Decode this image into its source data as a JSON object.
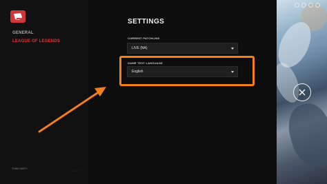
{
  "nav": {
    "items": [
      {
        "label": "GENERAL",
        "active": false
      },
      {
        "label": "LEAGUE OF LEGENDS",
        "active": true
      }
    ],
    "footer_link": "THIRD PARTY",
    "version": "0.0.0.0"
  },
  "main": {
    "title": "SETTINGS",
    "patchline": {
      "label": "CURRENT PATCHLINE",
      "value": "LIVE (NA)"
    },
    "language": {
      "label": "GAME TEXT LANGUAGE",
      "value": "English"
    }
  },
  "colors": {
    "accent_red": "#e2343a",
    "highlight_orange": "#f07f1c"
  },
  "icons": {
    "logo": "riot-fist-icon",
    "close": "close-icon",
    "dropdown": "chevron-down-icon"
  }
}
